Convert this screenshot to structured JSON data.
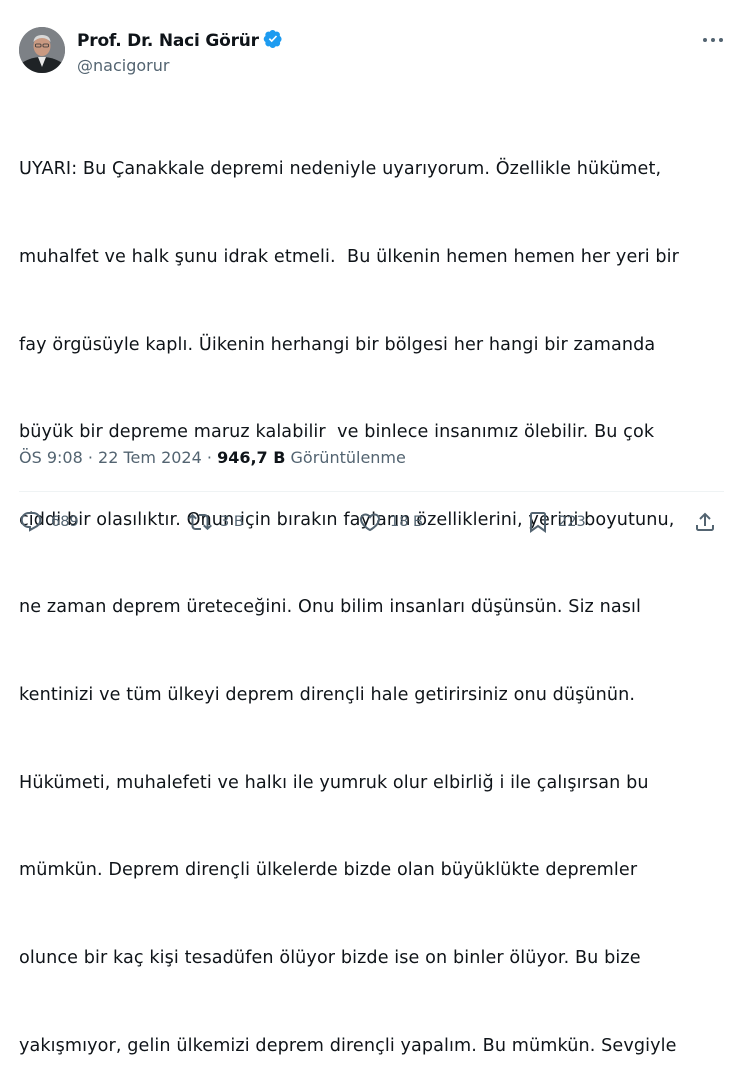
{
  "author": {
    "name": "Prof. Dr. Naci Görür",
    "handle": "@nacigorur",
    "verified": true
  },
  "tweet": {
    "lines": [
      "UYARI: Bu Çanakkale depremi nedeniyle uyarıyorum. Özellikle hükümet,",
      "muhalfet ve halk şunu idrak etmeli.  Bu ülkenin hemen hemen her yeri bir",
      "fay örgüsüyle kaplı. Üikenin herhangi bir bölgesi her hangi bir zamanda",
      "büyük bir depreme maruz kalabilir  ve binlece insanımız ölebilir. Bu çok",
      "ciddi bir olasılıktır. Onun için bırakın fayların özelliklerini, yerini boyutunu,",
      "ne zaman deprem üreteceğini. Onu bilim insanları düşünsün. Siz nasıl",
      "kentinizi ve tüm ülkeyi deprem dirençli hale getirirsiniz onu düşünün.",
      "Hükümeti, muhalefeti ve halkı ile yumruk olur elbirliğ i ile çalışırsan bu",
      "mümkün. Deprem dirençli ülkelerde bizde olan büyüklükte depremler",
      "olunce bir kaç kişi tesadüfen ölüyor bizde ise on binler ölüyor. Bu bize",
      "yakışmıyor, gelin ülkemizi deprem dirençli yapalım. Bu mümkün. Sevgiyle"
    ]
  },
  "meta": {
    "time": "ÖS 9:08",
    "separator": "·",
    "date": "22 Tem 2024",
    "views_count": "946,7 B",
    "views_label": "Görüntülenme"
  },
  "actions": {
    "replies": "689",
    "reposts": "3 B",
    "likes": "18 B",
    "bookmarks": "223"
  },
  "colors": {
    "text": "#0f1419",
    "secondary": "#536471",
    "verified": "#1d9bf0",
    "divider": "#eff3f4"
  },
  "icons": [
    "verified-badge-icon",
    "more-icon",
    "reply-icon",
    "repost-icon",
    "like-icon",
    "bookmark-icon",
    "share-icon"
  ]
}
